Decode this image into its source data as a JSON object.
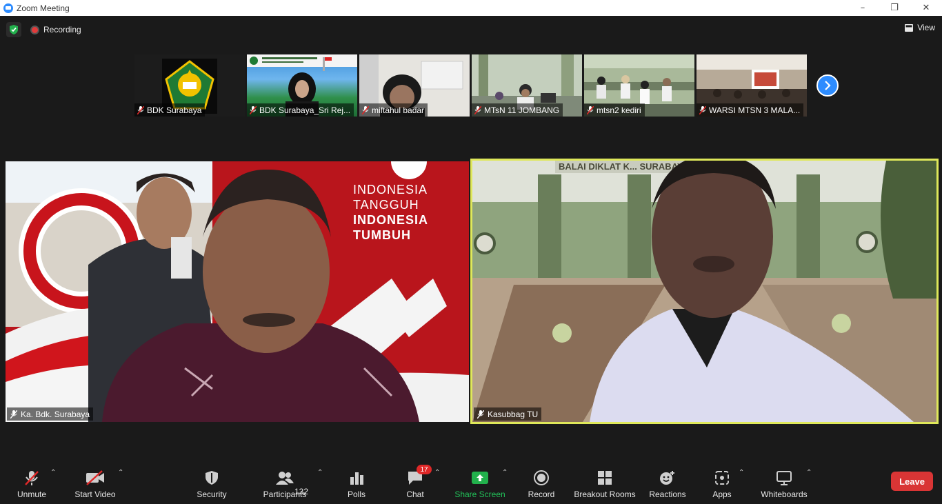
{
  "window": {
    "title": "Zoom Meeting",
    "controls": [
      "–",
      "❐",
      "✕"
    ]
  },
  "topbar": {
    "recording_label": "Recording",
    "view_label": "View"
  },
  "thumbnails": [
    {
      "name": "BDK Surabaya"
    },
    {
      "name": "BDK Surabaya_Sri Rej..."
    },
    {
      "name": "miftahul badar"
    },
    {
      "name": "MTsN 11 JOMBANG"
    },
    {
      "name": "mtsn2 kediri"
    },
    {
      "name": "WARSI MTSN 3 MALA..."
    }
  ],
  "main_tiles": [
    {
      "name": "Ka. Bdk. Surabaya",
      "banner": [
        "INDONESIA",
        "TANGGUH",
        "INDONESIA",
        "TUMBUH"
      ]
    },
    {
      "name": "Kasubbag TU",
      "sign": "BALAI DIKLAT K... SURABAYA"
    }
  ],
  "toolbar": {
    "unmute": "Unmute",
    "start_video": "Start Video",
    "security": "Security",
    "participants": "Participants",
    "participants_count": "132",
    "polls": "Polls",
    "chat": "Chat",
    "chat_badge": "17",
    "share_screen": "Share Screen",
    "record": "Record",
    "breakout_rooms": "Breakout Rooms",
    "reactions": "Reactions",
    "apps": "Apps",
    "whiteboards": "Whiteboards",
    "leave": "Leave"
  },
  "colors": {
    "accent": "#2d8cff",
    "active_speaker": "#dfe85a",
    "leave": "#d93535",
    "share": "#22b14c"
  }
}
